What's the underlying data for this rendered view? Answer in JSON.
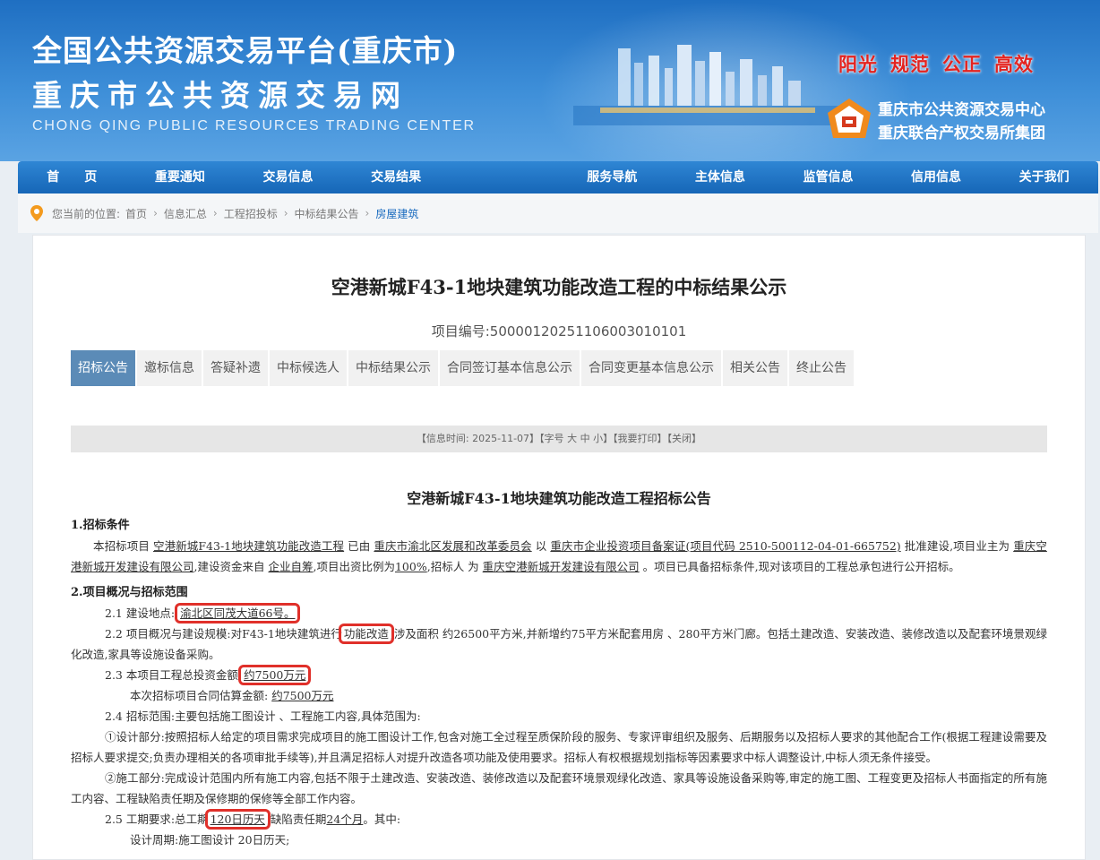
{
  "header": {
    "title_line1": "全国公共资源交易平台(重庆市)",
    "title_line2": "重庆市公共资源交易网",
    "title_en": "CHONG QING PUBLIC RESOURCES TRADING CENTER",
    "slogans": [
      "阳光",
      "规范",
      "公正",
      "高效"
    ],
    "org_name1": "重庆市公共资源交易中心",
    "org_name2": "重庆联合产权交易所集团",
    "logo_icon": "org-logo-icon",
    "slogan_color": "#e4231f"
  },
  "nav": {
    "items": [
      "首　　页",
      "重要通知",
      "交易信息",
      "交易结果",
      "",
      "服务导航",
      "主体信息",
      "监管信息",
      "信用信息",
      "关于我们"
    ]
  },
  "breadcrumb": {
    "prefix": "您当前的位置:",
    "items": [
      "首页",
      "信息汇总",
      "工程招投标",
      "中标结果公告",
      "房屋建筑"
    ],
    "separator": "›"
  },
  "page": {
    "title": "空港新城F43-1地块建筑功能改造工程的中标结果公示",
    "project_no": "项目编号:500001202511060030101​01",
    "tabs": [
      "招标公告",
      "邀标信息",
      "答疑补遗",
      "中标候选人",
      "中标结果公示",
      "合同签订基本信息公示",
      "合同变更基本信息公示",
      "相关公告",
      "终止公告"
    ],
    "active_tab": 0,
    "info_bar": {
      "time": "【信息时间: 2025-11-07】",
      "font_prefix": "【字号",
      "font_large": "大",
      "font_medium": "中",
      "font_small": "小",
      "font_suffix": "】",
      "print": "【我要打印】",
      "close": "【关闭】"
    },
    "accent_color": "#5b8bb7",
    "highlight_color": "#e0302a"
  },
  "doc": {
    "title": "空港新城F43-1地块建筑功能改造工程招标公告",
    "s1_heading": "1.招标条件",
    "s1": {
      "t1": "本招标项目",
      "project_name": "空港新城F43-1地块建筑功能改造工程",
      "t2": "已由",
      "approver": "重庆市渝北区发展和改革委员会",
      "t3": "以",
      "approval_doc": "重庆市企业投资项目备案证(项目代码 2510-500112-04-01-665752)",
      "t4": "批准建设,项目业主为",
      "owner": "重庆空港新城开发建设有限公司",
      "t5": ",建设资金来自",
      "fund_source": "企业自筹",
      "t6": ",项目出资比例为",
      "ratio": "100%",
      "t7": ",招标人 为",
      "tenderer": "重庆空港新城开发建设有限公司",
      "t8": "。项目已具备招标条件,现对该项目的工程总承包进行公开招标。"
    },
    "s2_heading": "2.项目概况与招标范围",
    "s21_label": "2.1 建设地点:",
    "s21_value": "渝北区同茂大道66号。",
    "s22_label": "2.2 项目概况与建设规模:对F43-1地块建筑进行",
    "s22_highlight": "功能改造",
    "s22_rest": ",涉及面积 约26500平方米,并新增约75平方米配套用房 、280平方米门廊。包括土建改造、安装改造、装修改造以及配套环境景观绿化改造,家具等设施设备采购。",
    "s23_label": "2.3 本项目工程总投资金额:",
    "s23_value": "约7500万元",
    "s23b_label": "本次招标项目合同估算金额:",
    "s23b_value": "约7500万元",
    "s24": "2.4 招标范围:主要包括施工图设计 、工程施工内容,具体范围为:",
    "s24_design": "①设计部分:按照招标人给定的项目需求完成项目的施工图设计工作,包含对施工全过程至质保阶段的服务、专家评审组织及服务、后期服务以及招标人要求的其他配合工作(根据工程建设需要及招标人要求提交;负责办理相关的各项审批手续等),并且满足招标人对提升改造各项功能及使用要求。招标人有权根据规划指标等因素要求中标人调整设计,中标人须无条件接受。",
    "s24_construction": "②施工部分:完成设计范围内所有施工内容,包括不限于土建改造、安装改造、装修改造以及配套环境景观绿化改造、家具等设施设备采购等,审定的施工图、工程变更及招标人书面指定的所有施工内容、工程缺陷责任期及保修期的保修等全部工作内容。",
    "s25_label": "2.5 工期要求:总工期",
    "s25_value": "120日历天",
    "s25_mid": ",缺陷责任期",
    "s25_defect": "24个月",
    "s25_end": "。其中:",
    "s25_next": "设计周期:施工图设计 20日历天;"
  }
}
